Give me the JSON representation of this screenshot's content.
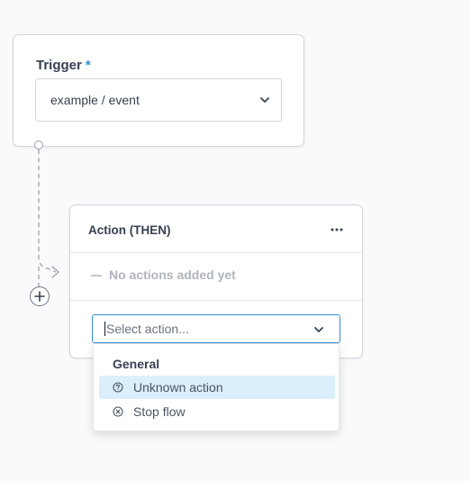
{
  "trigger": {
    "title": "Trigger",
    "required_mark": "*",
    "selected_event": "example / event"
  },
  "action": {
    "title": "Action (THEN)",
    "empty_text": "No actions added yet",
    "select_placeholder": "Select action..."
  },
  "dropdown": {
    "group_label": "General",
    "options": [
      {
        "label": "Unknown action",
        "icon": "question-circle-icon",
        "highlighted": true
      },
      {
        "label": "Stop flow",
        "icon": "x-circle-icon",
        "highlighted": false
      }
    ]
  },
  "colors": {
    "accent": "#2f8fd4",
    "highlight": "#dbeefb",
    "border": "#d1d5db",
    "background": "#f9fafb"
  }
}
